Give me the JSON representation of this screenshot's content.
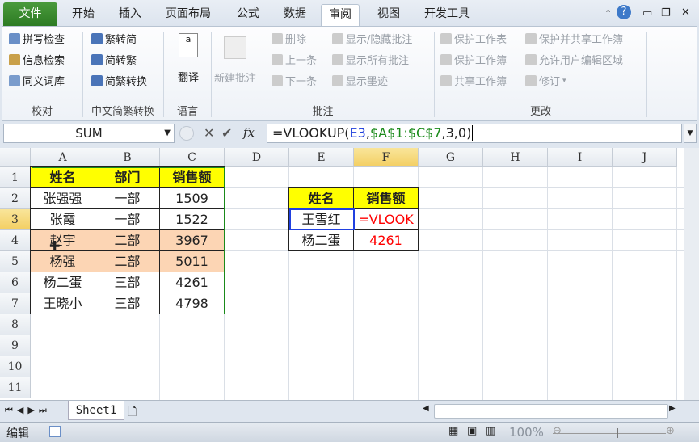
{
  "tabs": {
    "file": "文件",
    "items": [
      "开始",
      "插入",
      "页面布局",
      "公式",
      "数据",
      "审阅",
      "视图",
      "开发工具"
    ],
    "active": "审阅"
  },
  "ribbon": {
    "proofing": {
      "items": [
        "拼写检查",
        "信息检索",
        "同义词库"
      ],
      "label": "校对"
    },
    "chinese": {
      "items": [
        "繁转简",
        "简转繁",
        "简繁转换"
      ],
      "label": "中文简繁转换"
    },
    "language": {
      "translate": "翻译",
      "label": "语言"
    },
    "comments": {
      "new": "新建批注",
      "items": [
        "删除",
        "上一条",
        "下一条"
      ],
      "items2": [
        "显示/隐藏批注",
        "显示所有批注",
        "显示墨迹"
      ],
      "label": "批注"
    },
    "changes": {
      "items": [
        "保护工作表",
        "保护工作簿",
        "共享工作簿"
      ],
      "items2": [
        "保护并共享工作簿",
        "允许用户编辑区域",
        "修订"
      ],
      "label": "更改"
    }
  },
  "formula_bar": {
    "name_box": "SUM",
    "fx": "fx",
    "formula_prefix": "=VLOOKUP(",
    "arg1": "E3",
    "sep": ",",
    "arg2": "$A$1:$C$7",
    "suffix": ",3,0)"
  },
  "columns": [
    "A",
    "B",
    "C",
    "D",
    "E",
    "F",
    "G",
    "H",
    "I",
    "J"
  ],
  "rows": [
    "1",
    "2",
    "3",
    "4",
    "5",
    "6",
    "7",
    "8",
    "9",
    "10",
    "11"
  ],
  "table1": [
    [
      "姓名",
      "部门",
      "销售额"
    ],
    [
      "张强强",
      "一部",
      "1509"
    ],
    [
      "张霞",
      "一部",
      "1522"
    ],
    [
      "赵宇",
      "二部",
      "3967"
    ],
    [
      "杨强",
      "二部",
      "5011"
    ],
    [
      "杨二蛋",
      "三部",
      "4261"
    ],
    [
      "王晓小",
      "三部",
      "4798"
    ]
  ],
  "table2": [
    [
      "姓名",
      "销售额"
    ],
    [
      "王雪红",
      "=VLOOK"
    ],
    [
      "杨二蛋",
      "4261"
    ]
  ],
  "colors": {
    "header_fill": "#ffff00",
    "highlight_fill": "#fcd5b4",
    "red_text": "#ff0000"
  },
  "sheet_tab": "Sheet1",
  "status": {
    "mode": "编辑",
    "zoom": "100%"
  }
}
